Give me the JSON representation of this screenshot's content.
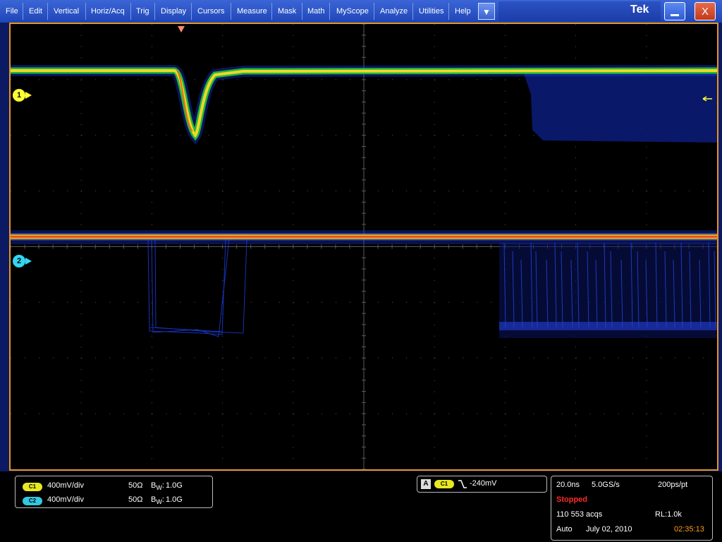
{
  "menu": {
    "items": [
      "File",
      "Edit",
      "Vertical",
      "Horiz/Acq",
      "Trig",
      "Display",
      "Cursors",
      "Measure",
      "Mask",
      "Math",
      "MyScope",
      "Analyze",
      "Utilities",
      "Help"
    ],
    "brand": "Tek",
    "close_label": "X"
  },
  "channels": {
    "ch1": {
      "marker": "1",
      "badge": "C1",
      "scale": "400mV/div",
      "impedance": "50Ω",
      "bw": "1.0G",
      "color": "#ffff33"
    },
    "ch2": {
      "marker": "2",
      "badge": "C2",
      "scale": "400mV/div",
      "impedance": "50Ω",
      "bw": "1.0G",
      "color": "#33d6f0"
    }
  },
  "trigger": {
    "label": "A",
    "source": "C1",
    "slope_icon": "falling-edge",
    "level": "-240mV"
  },
  "acquisition": {
    "time_div": "20.0ns",
    "sample_rate": "5.0GS/s",
    "resolution": "200ps/pt",
    "state": "Stopped",
    "acqs": "110 553 acqs",
    "record_length": "RL:1.0k",
    "mode": "Auto",
    "date": "July 02, 2010",
    "time": "02:35:13"
  },
  "colors": {
    "frame": "#e8961e",
    "menu_bar": "#2a52c8",
    "stopped": "#ff2a2a",
    "clock": "#ff9c1a"
  }
}
